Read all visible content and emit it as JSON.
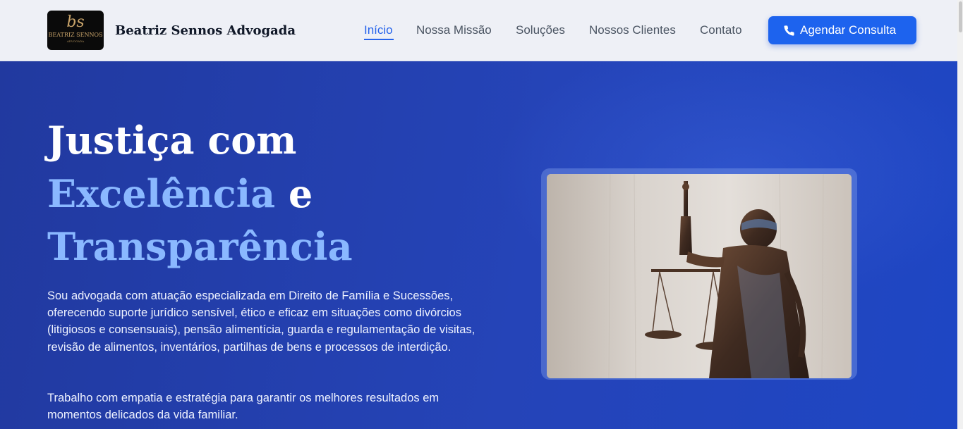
{
  "brand": {
    "logo_monogram": "bs",
    "logo_name": "BEATRIZ SENNOS",
    "logo_sub": "ADVOGADA",
    "name": "Beatriz Sennos Advogada"
  },
  "nav": {
    "items": [
      {
        "label": "Início",
        "active": true
      },
      {
        "label": "Nossa Missão",
        "active": false
      },
      {
        "label": "Soluções",
        "active": false
      },
      {
        "label": "Nossos Clientes",
        "active": false
      },
      {
        "label": "Contato",
        "active": false
      }
    ],
    "cta_label": "Agendar Consulta",
    "cta_icon": "phone-icon"
  },
  "hero": {
    "title_line1": "Justiça com",
    "title_accent1": "Excelência",
    "title_connector": " e",
    "title_accent2": "Transparência",
    "paragraph1": "Sou advogada com atuação especializada em Direito de Família e Sucessões, oferecendo suporte jurídico sensível, ético e eficaz em situações como divórcios (litigiosos e consensuais), pensão alimentícia, guarda e regulamentação de visitas, revisão de alimentos, inventários, partilhas de bens e processos de interdição.",
    "paragraph2": "Trabalho com empatia e estratégia para garantir os melhores resultados em momentos delicados da vida familiar.",
    "image_subject": "lady-justice-statue"
  },
  "colors": {
    "accent": "#2563eb",
    "cta": "#1d63ee",
    "hero_bg": "#2544b8",
    "title_accent": "#8ab8ff"
  }
}
